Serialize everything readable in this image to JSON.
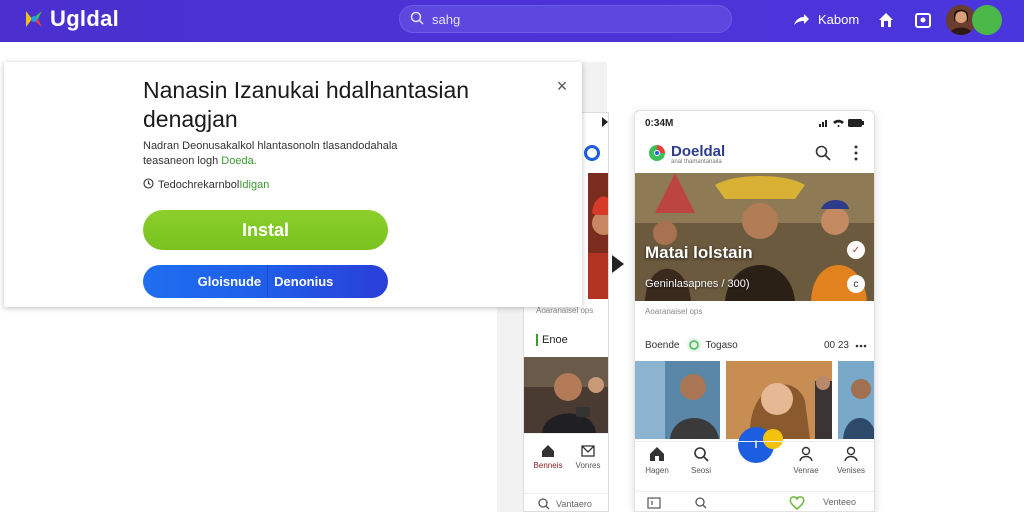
{
  "topbar": {
    "brand_name": "Ugldal",
    "search_placeholder": "sahg",
    "nav_text": "Kabom",
    "colors": {
      "bar": "#4b2fcf",
      "avatar_green": "#4cb84a"
    }
  },
  "dialog": {
    "title": "Nanasin Izanukai hdalhantasian denagjan",
    "description_main": "Nadran Deonusakalkol hlantasonoln tlasandodahala teasaneon logh",
    "description_highlight": "Doeda.",
    "note_text": "Tedochrekarnbol",
    "note_highlight": "Idigan",
    "install_label": "Instal",
    "secondary_left": "Gloisnude",
    "secondary_right": "Denonius",
    "close_symbol": "×"
  },
  "app_preview": {
    "status_time": "0:34M",
    "app_name": "Doeldal",
    "app_tagline": "anal thamantanaila",
    "hero_title": "Matai lolstain",
    "hero_sub": "Geninlasapnes / 300)",
    "divider": "Aoaranaisel ops",
    "left_label": "Enoe",
    "meta_left": "Boende",
    "meta_mid": "Togaso",
    "meta_right": "00 23",
    "fab_label": "l",
    "bottom_nav": [
      "Hagen",
      "Seosi",
      "Venrae",
      "Venises"
    ],
    "left_nav": [
      "Benneis",
      "Vonres"
    ],
    "row2_left": "Vantaero",
    "row2_right": "Venteeo"
  }
}
